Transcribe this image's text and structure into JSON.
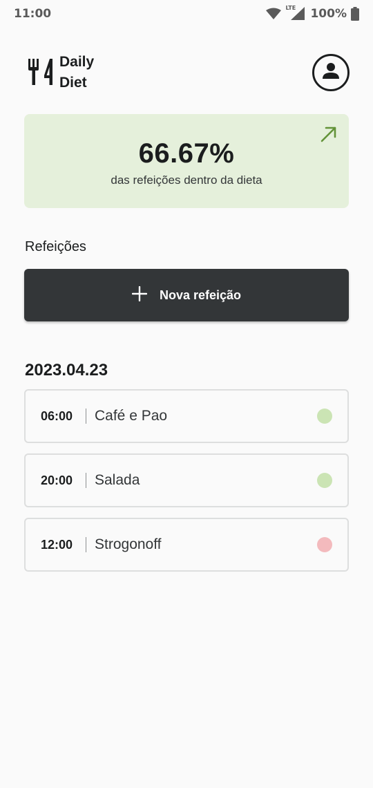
{
  "status_bar": {
    "time": "11:00",
    "network": "LTE",
    "battery": "100%"
  },
  "header": {
    "logo_line1": "Daily",
    "logo_line2": "Diet",
    "logo_icon": "fork-knife-icon",
    "profile_icon": "user-avatar-icon"
  },
  "stats": {
    "percent": "66.67%",
    "description": "das refeições dentro da dieta",
    "arrow_icon": "arrow-up-right-icon",
    "background_color": "#E5F0DB",
    "accent_color": "#639339"
  },
  "meals_section": {
    "title": "Refeições",
    "add_button_label": "Nova refeição",
    "add_icon": "plus-icon"
  },
  "days": [
    {
      "date": "2023.04.23",
      "meals": [
        {
          "time": "06:00",
          "name": "Café e Pao",
          "status_color": "#CBE4B4"
        },
        {
          "time": "20:00",
          "name": "Salada",
          "status_color": "#CBE4B4"
        },
        {
          "time": "12:00",
          "name": "Strogonoff",
          "status_color": "#F3BABD"
        }
      ]
    }
  ]
}
